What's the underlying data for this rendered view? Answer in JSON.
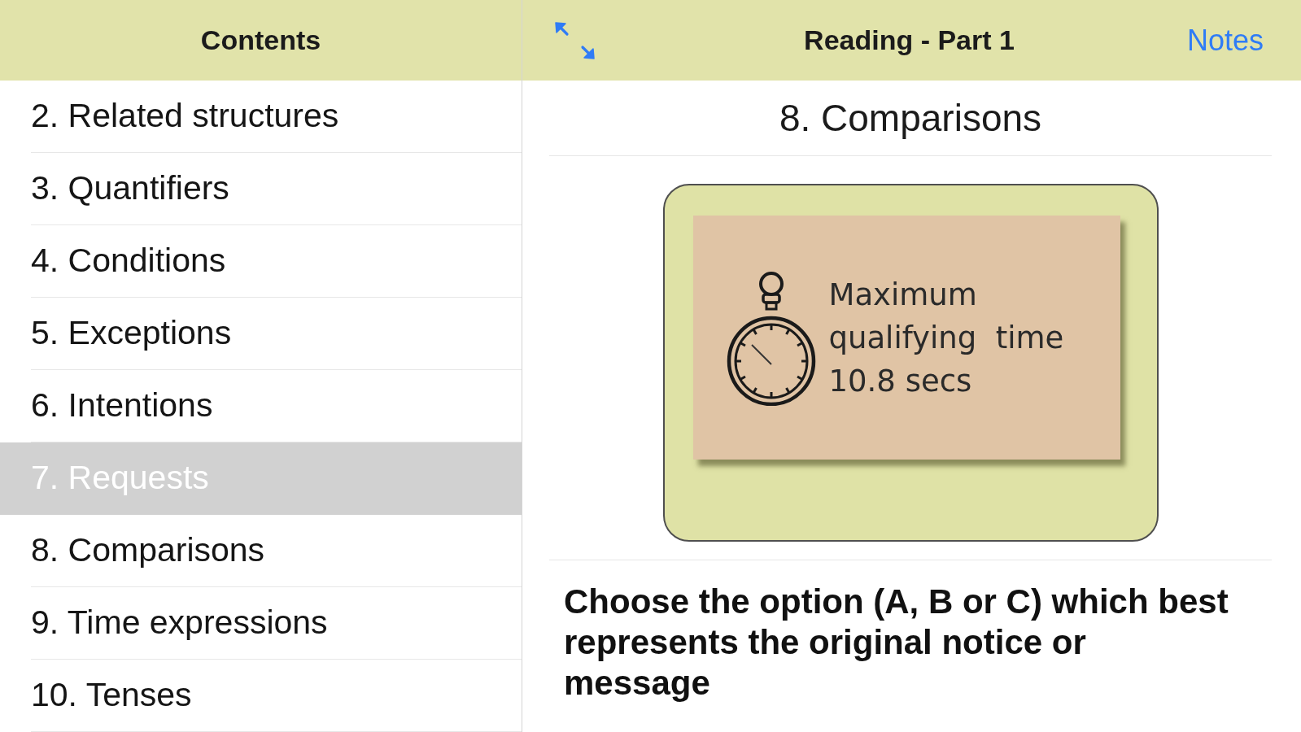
{
  "sidebar": {
    "title": "Contents",
    "items": [
      {
        "label": "2. Related structures",
        "selected": false
      },
      {
        "label": "3. Quantifiers",
        "selected": false
      },
      {
        "label": "4. Conditions",
        "selected": false
      },
      {
        "label": "5. Exceptions",
        "selected": false
      },
      {
        "label": "6. Intentions",
        "selected": false
      },
      {
        "label": "7. Requests",
        "selected": true
      },
      {
        "label": "8. Comparisons",
        "selected": false
      },
      {
        "label": "9. Time expressions",
        "selected": false
      },
      {
        "label": "10. Tenses",
        "selected": false
      }
    ]
  },
  "main": {
    "title": "Reading - Part 1",
    "notes_button": "Notes",
    "heading": "8. Comparisons",
    "notice": {
      "lines": [
        "Maximum",
        "qualifying  time",
        "10.8 secs"
      ]
    },
    "instruction": "Choose the option (A, B or C) which best represents the original notice or message"
  }
}
